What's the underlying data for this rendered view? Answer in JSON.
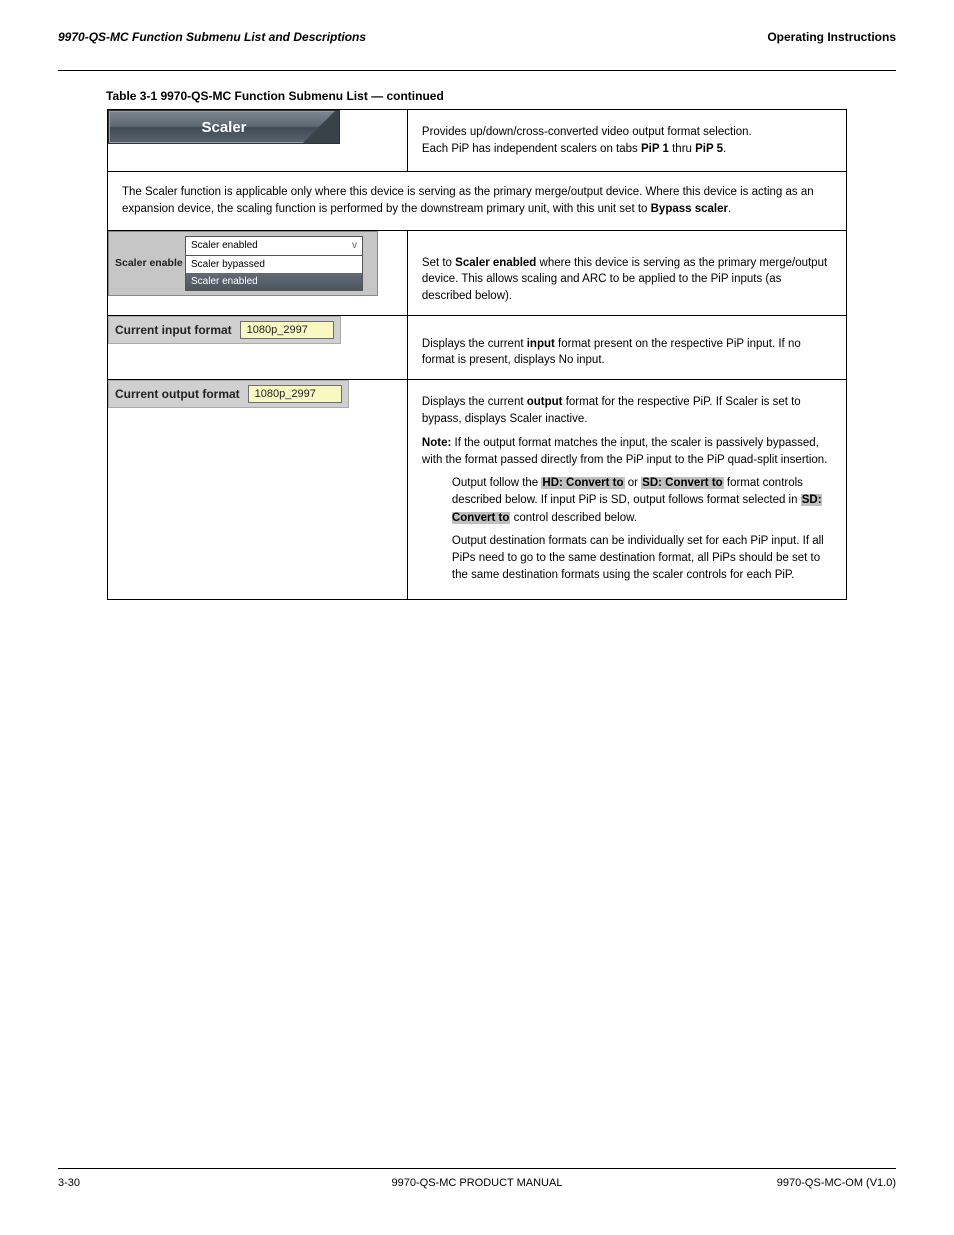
{
  "header": {
    "left": "9970-QS-MC Function Submenu List and Descriptions",
    "right": "Operating Instructions"
  },
  "table_caption": "Table 3-1  9970-QS-MC Function Submenu List — continued",
  "title_row": {
    "button_label": "Scaler",
    "description_line1": "Provides up/down/cross-converted video output format selection.",
    "description_line2_prefix": "Each PiP has independent scalers on tabs ",
    "description_line2_bold": "PiP 1",
    "description_line2_mid": " thru ",
    "description_line2_bold2": "PiP 5",
    "description_line2_suffix": "."
  },
  "scaler_note": {
    "prefix": "The Scaler function is applicable only where this device is serving as the primary merge/output device. Where this device is acting as an expansion device, the scaling function is performed by the downstream primary unit, with this unit set to ",
    "bold": "Bypass scaler",
    "suffix": "."
  },
  "scaler_enable": {
    "label": "Scaler enable",
    "selected": "Scaler enabled",
    "options": [
      "Scaler bypassed",
      "Scaler enabled"
    ],
    "desc_prefix": "Set to ",
    "desc_bold": "Scaler enabled",
    "desc_suffix": " where this device is serving as the primary merge/output device. This allows scaling and ARC to be applied to the PiP inputs (as described below)."
  },
  "current_input": {
    "label": "Current input format",
    "value": "1080p_2997",
    "desc_prefix": "Displays the current ",
    "desc_bold": "input",
    "desc_suffix": " format present on the respective PiP input. If no format is present, displays No input."
  },
  "current_output": {
    "label": "Current output format",
    "value": "1080p_2997",
    "desc_prefix": "Displays the current ",
    "desc_bold1": "output",
    "desc_mid1": " format for the respective PiP. If Scaler is set to bypass, displays Scaler inactive.",
    "desc_note_bold": "Note:",
    "desc_note_text1": " If the output format matches the input, the scaler is passively bypassed, with the format passed directly from the PiP input to the PiP quad-split insertion.",
    "desc_note_text2_prefix": "Output follow the ",
    "desc_hl1": "HD: Convert to",
    "desc_note_text2_mid1": " or ",
    "desc_hl2": "SD: Convert to",
    "desc_note_text2_mid2": " format controls described below. If input PiP is SD, output follows format selected in ",
    "desc_hl3": "SD: Convert to",
    "desc_note_text2_suffix": " control described below.",
    "desc_note_text3": "Output destination formats can be individually set for each PiP input. If all PiPs need to go to the same destination format, all PiPs should be set to the same destination formats using the scaler controls for each PiP."
  },
  "footer": {
    "left": "3-30",
    "center": "9970-QS-MC PRODUCT MANUAL",
    "right": "9970-QS-MC-OM (V1.0)"
  }
}
